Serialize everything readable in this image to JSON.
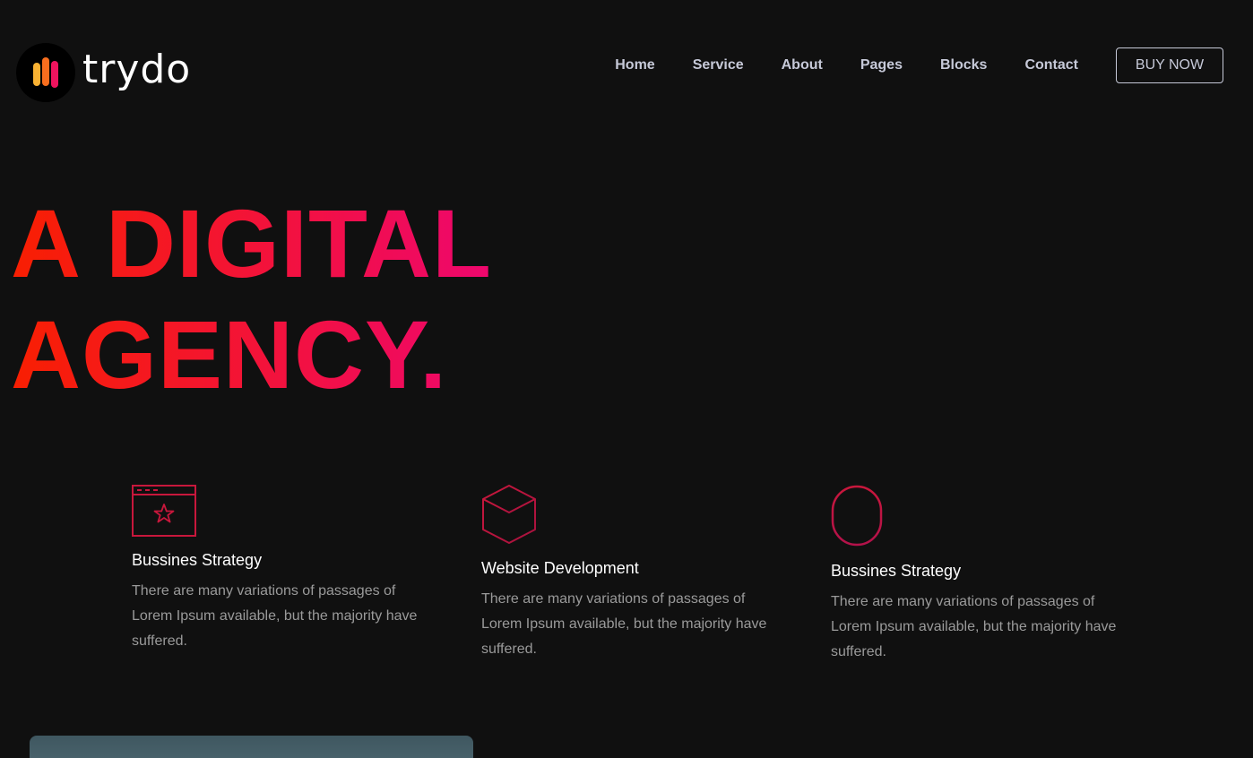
{
  "brand": {
    "name": "trydo"
  },
  "nav": {
    "items": [
      "Home",
      "Service",
      "About",
      "Pages",
      "Blocks",
      "Contact"
    ],
    "cta": "BUY NOW"
  },
  "hero": {
    "line1": "A DIGITAL",
    "line2": "AGENCY.",
    "gradient": [
      "#f81f01",
      "#ee076e"
    ]
  },
  "services": [
    {
      "icon": "browser-star-icon",
      "title": "Bussines Strategy",
      "desc": "There are many variations of passages of Lorem Ipsum available, but the majority have suffered."
    },
    {
      "icon": "cube-icon",
      "title": "Website Development",
      "desc": "There are many variations of passages of Lorem Ipsum available, but the majority have suffered."
    },
    {
      "icon": "mouse-icon",
      "title": "Bussines Strategy",
      "desc": "There are many variations of passages of Lorem Ipsum available, but the majority have suffered."
    }
  ],
  "colors": {
    "background": "#101010",
    "nav_text": "#c6c9d8",
    "icon_stroke": "#d01b3f"
  }
}
